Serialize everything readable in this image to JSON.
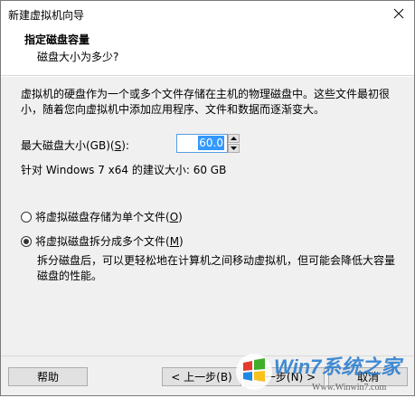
{
  "window": {
    "title": "新建虚拟机向导",
    "close_glyph": "✕"
  },
  "header": {
    "title": "指定磁盘容量",
    "subtitle": "磁盘大小为多少?"
  },
  "description": "虚拟机的硬盘作为一个或多个文件存储在主机的物理磁盘中。这些文件最初很小，随着您向虚拟机中添加应用程序、文件和数据而逐渐变大。",
  "disk_size": {
    "label_prefix": "最大磁盘大小(GB)(",
    "label_key": "S",
    "label_suffix": "):",
    "value": "60.0",
    "recommendation": "针对 Windows 7 x64 的建议大小: 60 GB"
  },
  "storage_options": [
    {
      "label_prefix": "将虚拟磁盘存储为单个文件(",
      "key": "O",
      "label_suffix": ")",
      "selected": false
    },
    {
      "label_prefix": "将虚拟磁盘拆分成多个文件(",
      "key": "M",
      "label_suffix": ")",
      "selected": true
    }
  ],
  "split_hint": "拆分磁盘后，可以更轻松地在计算机之间移动虚拟机，但可能会降低大容量磁盘的性能。",
  "buttons": {
    "help": "帮助",
    "back": "< 上一步(B)",
    "next": "下一步(N) >",
    "cancel": "取消"
  },
  "watermark": {
    "brand": "Win7系统之家",
    "url": "Www.Winwin7.com"
  },
  "colors": {
    "selection": "#3399ff",
    "focus_border": "#569de5",
    "button_face": "#e1e1e1",
    "dialog_bg": "#f0f0f0"
  }
}
